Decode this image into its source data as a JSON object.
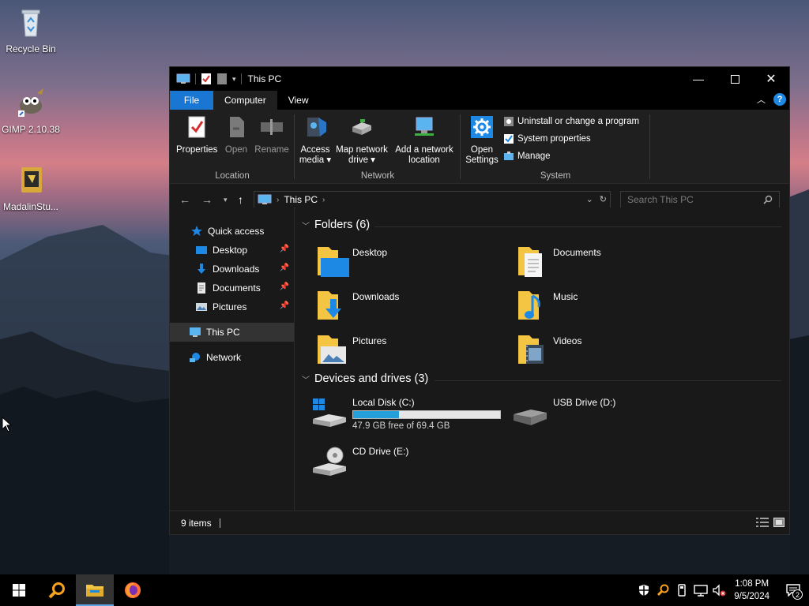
{
  "desktop": {
    "icons": [
      {
        "label": "Recycle Bin",
        "icon": "recycle-bin-icon"
      },
      {
        "label": "GIMP 2.10.38",
        "icon": "gimp-icon"
      },
      {
        "label": "MadalinStu...",
        "icon": "app-shortcut-icon"
      }
    ]
  },
  "window": {
    "title": "This PC",
    "tabs": {
      "file": "File",
      "computer": "Computer",
      "view": "View"
    },
    "ribbon": {
      "location": {
        "label": "Location",
        "properties": "Properties",
        "open": "Open",
        "rename": "Rename"
      },
      "network": {
        "label": "Network",
        "access_media_1": "Access",
        "access_media_2": "media ▾",
        "map_drive_1": "Map network",
        "map_drive_2": "drive ▾",
        "add_location_1": "Add a network",
        "add_location_2": "location"
      },
      "system": {
        "label": "System",
        "open_settings_1": "Open",
        "open_settings_2": "Settings",
        "uninstall": "Uninstall or change a program",
        "system_properties": "System properties",
        "manage": "Manage"
      }
    },
    "address": {
      "crumb": "This PC"
    },
    "search": {
      "placeholder": "Search This PC"
    },
    "nav": {
      "quick_access": "Quick access",
      "desktop": "Desktop",
      "downloads": "Downloads",
      "documents": "Documents",
      "pictures": "Pictures",
      "this_pc": "This PC",
      "network": "Network"
    },
    "folders_header": "Folders (6)",
    "folders": [
      "Desktop",
      "Documents",
      "Downloads",
      "Music",
      "Pictures",
      "Videos"
    ],
    "drives_header": "Devices and drives (3)",
    "drives": [
      {
        "name": "Local Disk (C:)",
        "free": "47.9 GB free of 69.4 GB",
        "used_fraction": 0.31
      },
      {
        "name": "USB Drive (D:)"
      },
      {
        "name": "CD Drive (E:)"
      }
    ],
    "status": {
      "items": "9 items"
    }
  },
  "taskbar": {
    "time": "1:08 PM",
    "date": "9/5/2024",
    "notifications": "2"
  },
  "colors": {
    "accent": "#1976d2",
    "drive_bar": "#26a0da",
    "folder": "#f4c542"
  }
}
